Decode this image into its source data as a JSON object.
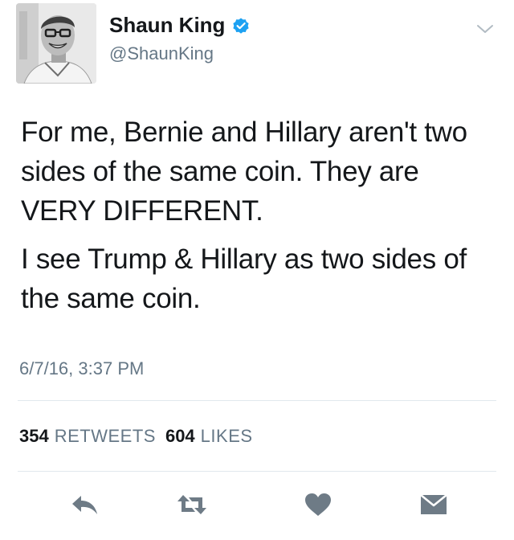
{
  "author": {
    "name": "Shaun King",
    "handle": "@ShaunKing",
    "verified": true
  },
  "tweet": {
    "paragraphs": [
      "For me, Bernie and Hillary aren't two sides of the same coin. They are VERY DIFFERENT.",
      "I see Trump & Hillary as two sides of the same coin."
    ],
    "timestamp": "6/7/16, 3:37 PM"
  },
  "stats": {
    "retweets_count": "354",
    "retweets_label": "RETWEETS",
    "likes_count": "604",
    "likes_label": "LIKES"
  },
  "icons": {
    "reply": "reply-icon",
    "retweet": "retweet-icon",
    "like": "heart-icon",
    "message": "envelope-icon",
    "menu": "chevron-down-icon",
    "verified": "verified-badge-icon"
  },
  "colors": {
    "verified_blue": "#1da1f2",
    "secondary_text": "#657786",
    "action_icon": "#6e7b86"
  }
}
